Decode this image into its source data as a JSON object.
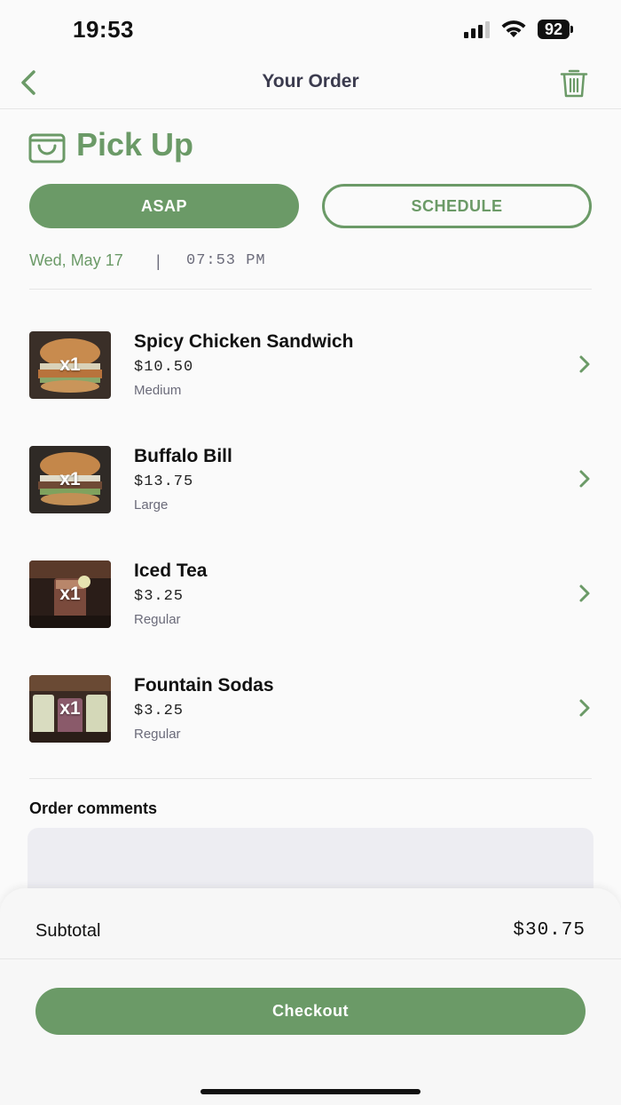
{
  "status": {
    "time": "19:53",
    "battery": "92"
  },
  "nav": {
    "title": "Your Order"
  },
  "pickup": {
    "title": "Pick Up",
    "asap_label": "ASAP",
    "schedule_label": "SCHEDULE",
    "date": "Wed, May 17",
    "separator": "|",
    "time": "07:53 PM"
  },
  "items": [
    {
      "name": "Spicy Chicken Sandwich",
      "price": "$10.50",
      "size": "Medium",
      "qty": "x1",
      "thumb": "burger"
    },
    {
      "name": "Buffalo Bill",
      "price": "$13.75",
      "size": "Large",
      "qty": "x1",
      "thumb": "burger"
    },
    {
      "name": "Iced Tea",
      "price": "$3.25",
      "size": "Regular",
      "qty": "x1",
      "thumb": "drink-dark"
    },
    {
      "name": "Fountain Sodas",
      "price": "$3.25",
      "size": "Regular",
      "qty": "x1",
      "thumb": "drink-light"
    }
  ],
  "comments": {
    "label": "Order comments",
    "value": ""
  },
  "summary": {
    "subtotal_label": "Subtotal",
    "subtotal_value": "$30.75",
    "checkout_label": "Checkout"
  },
  "colors": {
    "accent": "#6b9a67",
    "text_muted": "#6b6b7a"
  }
}
